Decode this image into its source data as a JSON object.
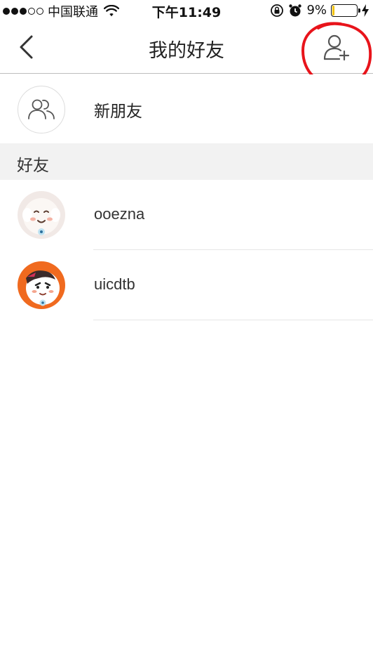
{
  "status_bar": {
    "carrier": "中国联通",
    "time": "下午11:49",
    "battery_percent": "9%",
    "battery_level": 0.09,
    "battery_color": "#f2c200",
    "signal_bars_filled": 3,
    "signal_bars_total": 5
  },
  "nav": {
    "title": "我的好友",
    "back_icon": "chevron-left-icon",
    "add_icon": "add-user-icon",
    "highlight_color": "#e8141b"
  },
  "new_friends": {
    "label": "新朋友",
    "icon": "group-icon"
  },
  "section": {
    "title": "好友"
  },
  "friends": [
    {
      "name": "ooezna",
      "avatar": "cartoon-avatar-white"
    },
    {
      "name": "uicdtb",
      "avatar": "cartoon-avatar-orange"
    }
  ]
}
